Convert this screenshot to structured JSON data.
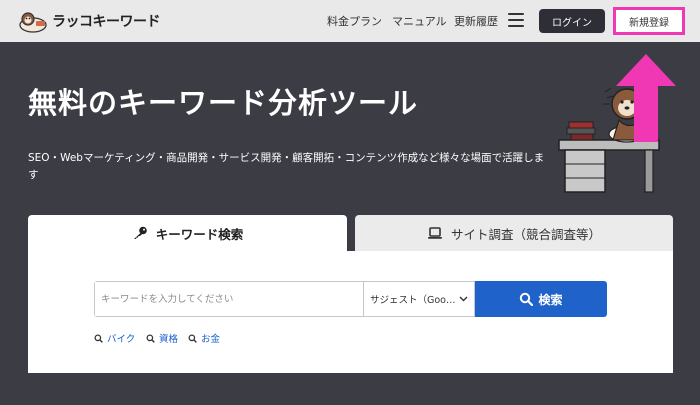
{
  "header": {
    "logo_text": "ラッコキーワード",
    "nav": [
      "料金プラン",
      "マニュアル",
      "更新履歴"
    ],
    "login_label": "ログイン",
    "register_label": "新規登録"
  },
  "hero": {
    "title": "無料のキーワード分析ツール",
    "subtitle": "SEO・Webマーケティング・商品開発・サービス開発・顧客開拓・コンテンツ作成など様々な場面で活躍します"
  },
  "tabs": [
    {
      "label": "キーワード検索",
      "icon": "key-icon",
      "active": true
    },
    {
      "label": "サイト調査（競合調査等）",
      "icon": "laptop-icon",
      "active": false
    }
  ],
  "search": {
    "placeholder": "キーワードを入力してください",
    "select_value": "サジェスト（Goo…",
    "button_label": "検索"
  },
  "suggestions": [
    "バイク",
    "資格",
    "お金"
  ],
  "colors": {
    "header_bg": "#e9e9ea",
    "hero_bg": "#3c3c44",
    "login_bg": "#2e2e36",
    "highlight_pink": "#f038b4",
    "search_btn": "#1f62c9",
    "link_blue": "#1a5fcf"
  }
}
